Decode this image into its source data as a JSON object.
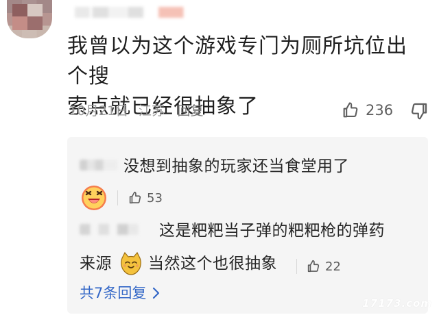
{
  "comment": {
    "text_line1": "我曾以为这个游戏专门为厕所坑位出个搜",
    "text_line2": "索点就已经很抽象了",
    "date": "10月21日",
    "location": "江苏",
    "reply_label": "回复",
    "like_count": "236"
  },
  "replies": [
    {
      "text": "没想到抽象的玩家还当食堂用了",
      "like_count": "53",
      "emoji": "laughing-face"
    },
    {
      "text_line1": "这是粑粑当子弹的粑粑枪的弹药",
      "text_line2_prefix": "来源",
      "text_line2_suffix": "当然这个也很抽象",
      "like_count": "22",
      "emoji": "cat-face"
    }
  ],
  "more_replies": "共7条回复",
  "watermark": "17173.com",
  "colors": {
    "link_blue": "#3367c7",
    "meta_gray": "#9a9a9a",
    "panel_gray": "#f5f5f5"
  }
}
